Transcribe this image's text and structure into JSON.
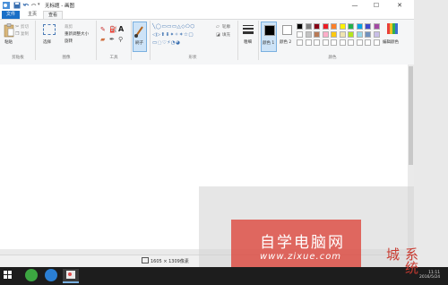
{
  "window": {
    "title": "无标题 - 画图",
    "minimize_label": "—",
    "maximize_label": "☐",
    "close_label": "✕"
  },
  "tabs": [
    {
      "label": "文件"
    },
    {
      "label": "主页"
    },
    {
      "label": "查看"
    }
  ],
  "ribbon": {
    "clipboard": {
      "paste": "粘贴",
      "cut": "剪切",
      "copy": "复制",
      "label": "剪贴板"
    },
    "image": {
      "select": "选择",
      "crop": "裁剪",
      "resize": "重新调整大小",
      "rotate": "旋转",
      "label": "图像"
    },
    "tools": {
      "label": "工具"
    },
    "brushes": {
      "label": "刷子"
    },
    "shapes": {
      "outline": "轮廓",
      "fill": "填充",
      "label": "形状"
    },
    "size": {
      "label": "粗细"
    },
    "colors": {
      "color1": "颜色 1",
      "color2": "颜色 2",
      "edit": "编辑颜色",
      "label": "颜色",
      "palette_row1": [
        "#000000",
        "#7f7f7f",
        "#880015",
        "#ed1c24",
        "#ff7f27",
        "#fff200",
        "#22b14c",
        "#00a2e8",
        "#3f48cc",
        "#a349a4"
      ],
      "palette_row2": [
        "#ffffff",
        "#c3c3c3",
        "#b97a57",
        "#ffaec9",
        "#ffc90e",
        "#efe4b0",
        "#b5e61d",
        "#99d9ea",
        "#7092be",
        "#c8bfe7"
      ]
    }
  },
  "status": {
    "dimensions": "1605 × 1309像素"
  },
  "taskbar": {
    "clock_time": "11:11",
    "clock_date": "2016/5/24"
  },
  "watermark": {
    "title": "自学电脑网",
    "url": "www.zixue.com",
    "side": "系统城"
  }
}
